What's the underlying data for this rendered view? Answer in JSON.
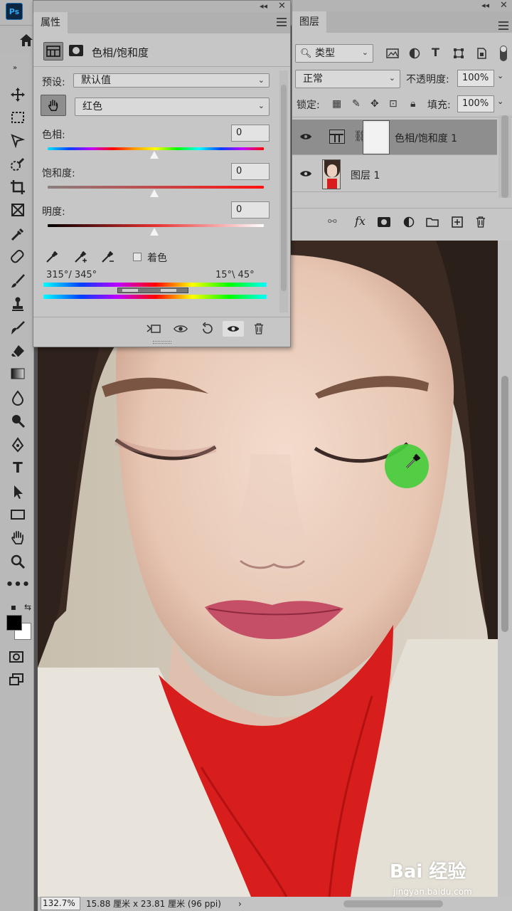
{
  "app": {
    "logo": "Ps"
  },
  "properties_panel": {
    "tab_label": "属性",
    "adjustment_title": "色相/饱和度",
    "preset_label": "预设:",
    "preset_value": "默认值",
    "channel_value": "红色",
    "hue": {
      "label": "色相:",
      "value": "0",
      "level": 0
    },
    "saturation": {
      "label": "饱和度:",
      "value": "0",
      "level": 0
    },
    "lightness": {
      "label": "明度:",
      "value": "0",
      "level": 0
    },
    "colorize_label": "着色",
    "colorize_checked": false,
    "range_left": "315°/ 345°",
    "range_right": "15°\\ 45°"
  },
  "layers_panel": {
    "tab_label": "图层",
    "filter_kind": "类型",
    "blend_mode": "正常",
    "opacity_label": "不透明度:",
    "opacity_value": "100%",
    "lock_label": "锁定:",
    "fill_label": "填充:",
    "fill_value": "100%",
    "layers": [
      {
        "name": "色相/饱和度 1",
        "selected": true,
        "visible": true
      },
      {
        "name": "图层 1",
        "selected": false,
        "visible": true
      }
    ]
  },
  "status_bar": {
    "zoom": "132.7%",
    "doc_size": "15.88 厘米 x 23.81 厘米 (96 ppi)",
    "arrow": "›"
  },
  "foreground_color": "#000000",
  "background_color": "#ffffff",
  "cursor_color": "#46cd3c",
  "watermark": {
    "brand": "Bai 经验",
    "url": "jingyan.baidu.com"
  }
}
